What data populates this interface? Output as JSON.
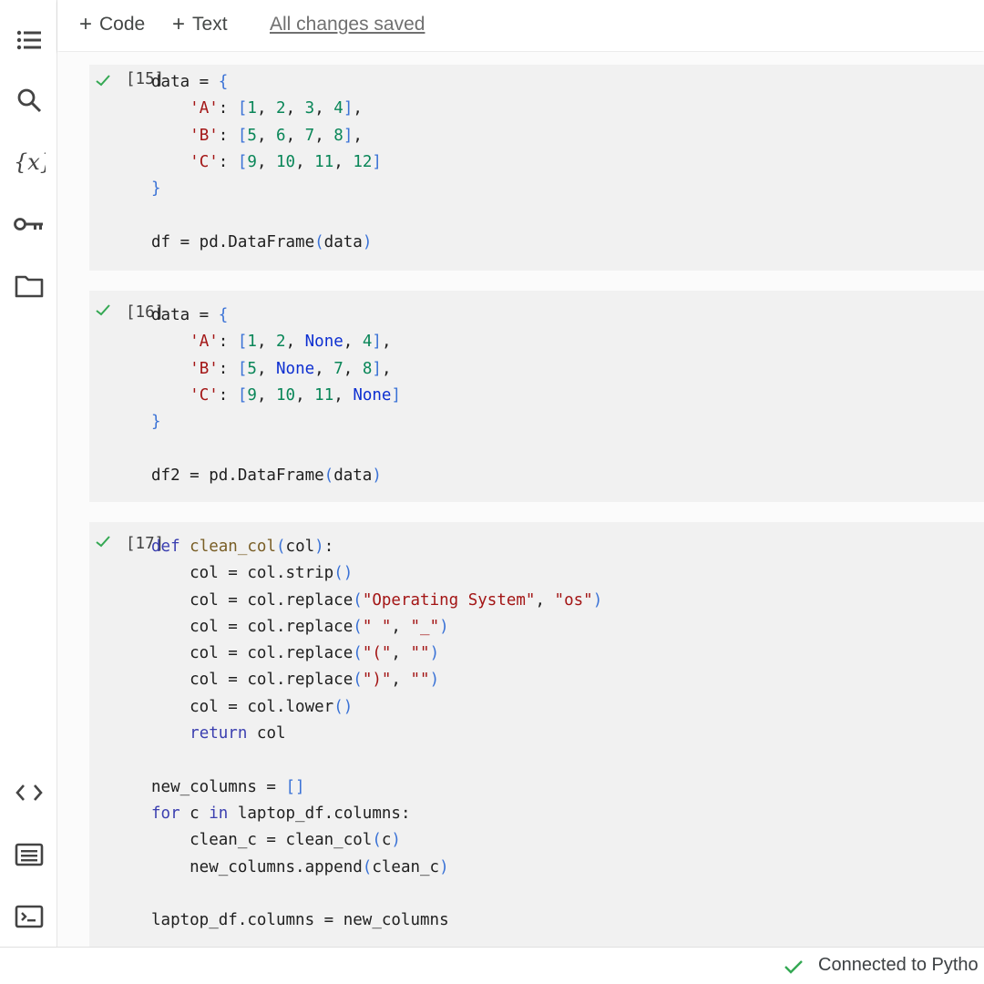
{
  "toolbar": {
    "add_code_label": "Code",
    "add_text_label": "Text",
    "save_status": "All changes saved"
  },
  "sidebar": {
    "icons": [
      "table-of-contents-icon",
      "search-icon",
      "variables-icon",
      "secrets-key-icon",
      "files-folder-icon",
      "code-snippets-icon",
      "command-palette-icon",
      "terminal-icon"
    ]
  },
  "cells": [
    {
      "execution_count": "[15]",
      "status": "success"
    },
    {
      "execution_count": "[16]",
      "status": "success"
    },
    {
      "execution_count": "[17]",
      "status": "success"
    }
  ],
  "status_bar": {
    "text": "Connected to Pytho"
  },
  "colors": {
    "check": "#34a853",
    "keyword": "#3b3fb0",
    "number": "#098658",
    "string": "#a31515",
    "none": "#0d2fd1"
  }
}
